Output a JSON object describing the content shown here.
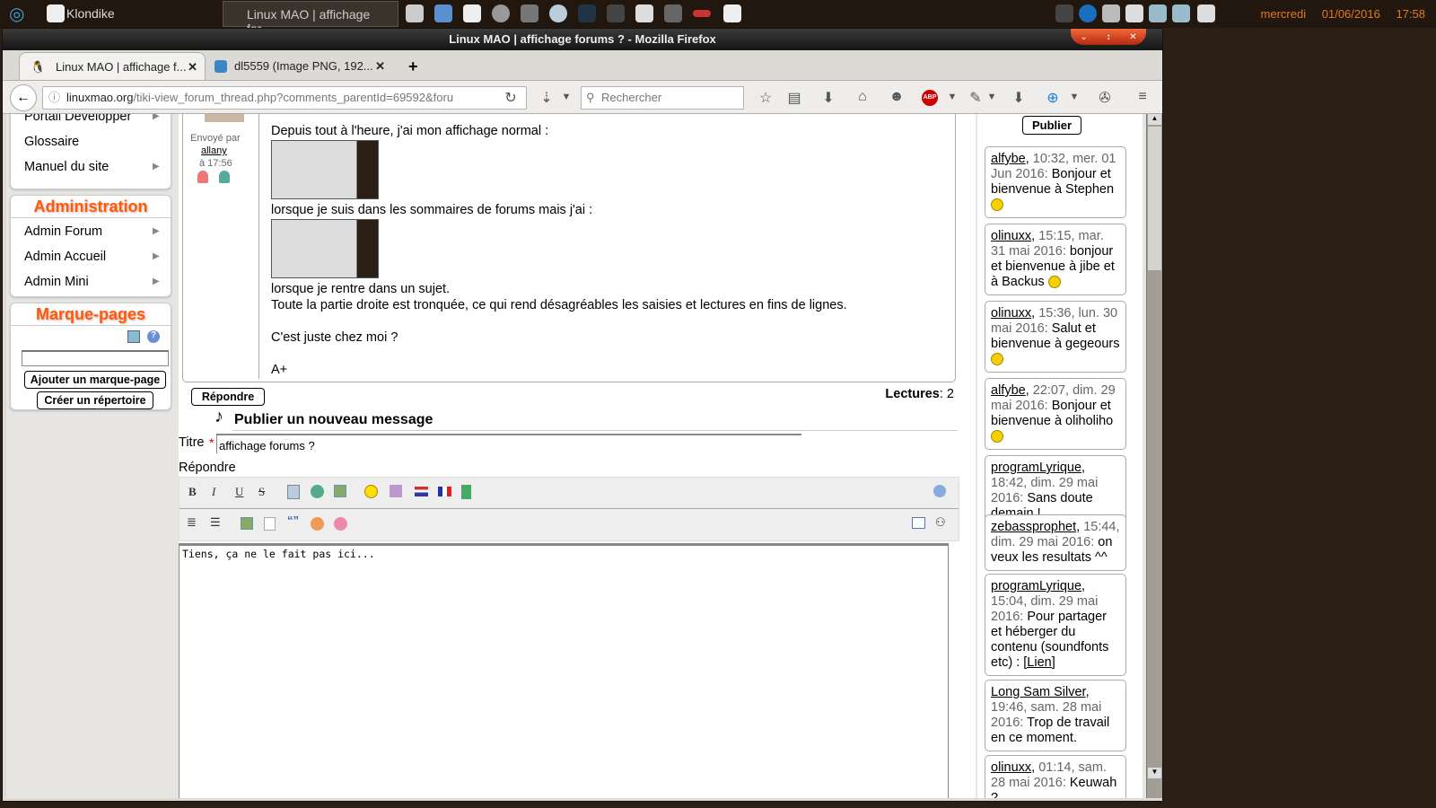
{
  "taskbar": {
    "active_app": "Klondike",
    "window_button": "Linux MAO | affichage for...",
    "clock_day": "mercredi",
    "clock_date": "01/06/2016",
    "clock_time": "17:58"
  },
  "window": {
    "title": "Linux MAO | affichage forums ? - Mozilla Firefox"
  },
  "tabs": [
    {
      "label": "Linux MAO | affichage f..."
    },
    {
      "label": "dl5559 (Image PNG, 192..."
    }
  ],
  "url": {
    "host": "linuxmao.org",
    "path": "/tiki-view_forum_thread.php?comments_parentId=69592&foru"
  },
  "search": {
    "placeholder": "Rechercher"
  },
  "sidebar": {
    "menu_top": [
      {
        "label": "Portail Développer"
      },
      {
        "label": "Glossaire"
      },
      {
        "label": "Manuel du site"
      }
    ],
    "admin_title": "Administration",
    "admin_items": [
      {
        "label": "Admin Forum"
      },
      {
        "label": "Admin Accueil"
      },
      {
        "label": "Admin Mini"
      }
    ],
    "bookmarks_title": "Marque-pages",
    "add_bookmark": "Ajouter un marque-page",
    "create_folder": "Créer un répertoire"
  },
  "post": {
    "sent_by": "Envoyé par",
    "author": "allany",
    "time": "à 17:56",
    "lines": [
      "Depuis tout à l'heure, j'ai mon affichage normal :",
      "lorsque je suis dans les sommaires de forums mais j'ai :",
      "lorsque je rentre dans un sujet.",
      "Toute la partie droite est tronquée, ce qui rend désagréables les saisies et lectures en fins de lignes.",
      "C'est juste chez moi ?",
      "A+"
    ]
  },
  "reply_button": "Répondre",
  "reads_label": "Lectures",
  "reads_value": "2",
  "new_message": {
    "heading": "Publier un nouveau message",
    "title_label": "Titre",
    "title_value": "affichage forums ?",
    "reply_label": "Répondre",
    "body": "Tiens, ça ne le fait pas ici..."
  },
  "shoutbox": {
    "publish": "Publier",
    "items": [
      {
        "user": "alfybe",
        "date": "10:32, mer. 01 Jun 2016",
        "msg": "Bonjour et bienvenue à Stephen",
        "smiley": true
      },
      {
        "user": "olinuxx",
        "date": "15:15, mar. 31 mai 2016",
        "msg": "bonjour et bienvenue à jibe et à Backus",
        "smiley": true
      },
      {
        "user": "olinuxx",
        "date": "15:36, lun. 30 mai 2016",
        "msg": "Salut et bienvenue à gegeours",
        "smiley": true
      },
      {
        "user": "alfybe",
        "date": "22:07, dim. 29 mai 2016",
        "msg": "Bonjour et bienvenue à oliholiho",
        "smiley": true
      },
      {
        "user": "programLyrique",
        "date": "18:42, dim. 29 mai 2016",
        "msg": "Sans doute demain !"
      },
      {
        "user": "zebassprophet",
        "date": "15:44, dim. 29 mai 2016",
        "msg": "on veux les resultats ^^"
      },
      {
        "user": "programLyrique",
        "date": "15:04, dim. 29 mai 2016",
        "msg": "Pour partager et héberger du contenu (soundfonts etc) :",
        "link": "[Lien]"
      },
      {
        "user": "Long Sam Silver",
        "date": "19:46, sam. 28 mai 2016",
        "msg": "Trop de travail en ce moment."
      },
      {
        "user": "olinuxx",
        "date": "01:14, sam. 28 mai 2016",
        "msg": "Keuwah ?"
      }
    ]
  }
}
